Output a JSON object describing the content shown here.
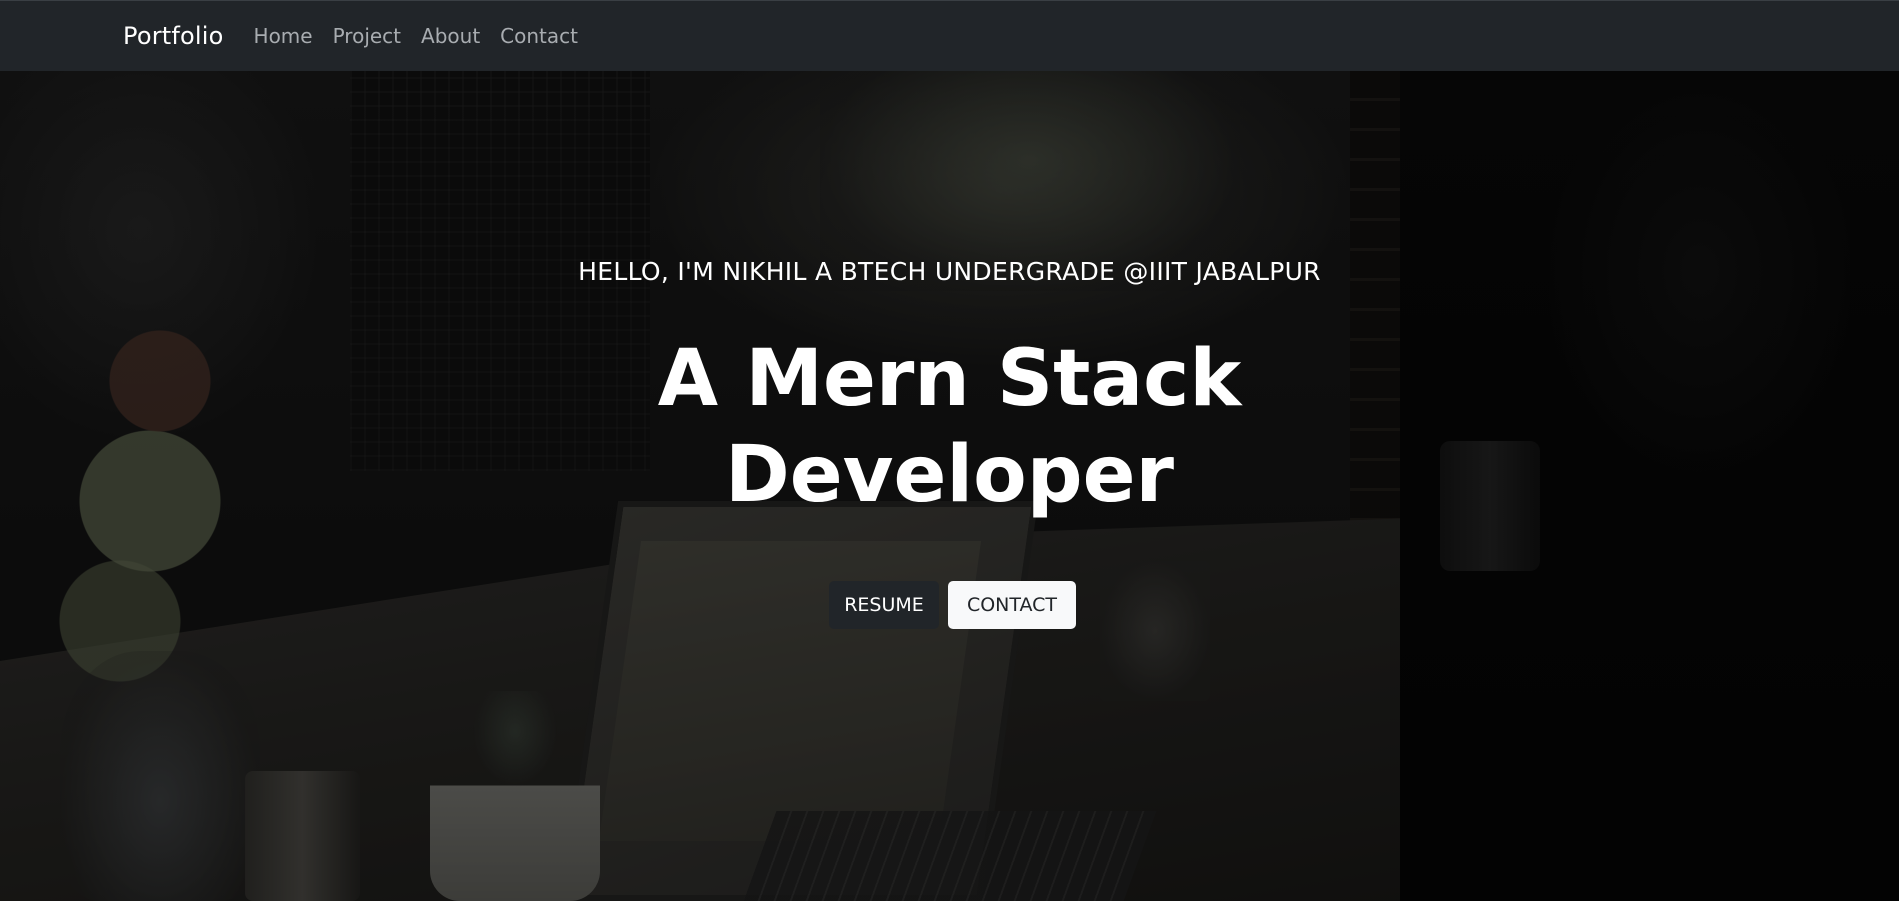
{
  "navbar": {
    "brand": "Portfolio",
    "links": [
      {
        "label": "Home"
      },
      {
        "label": "Project"
      },
      {
        "label": "About"
      },
      {
        "label": "Contact"
      }
    ]
  },
  "hero": {
    "tagline": "HELLO, I'M NIKHIL A BTECH UNDERGRADE @IIIT JABALPUR",
    "headline_line1": "A Mern Stack",
    "headline_line2": "Developer",
    "buttons": {
      "resume": "RESUME",
      "contact": "CONTACT"
    }
  },
  "colors": {
    "navbar_bg": "#212529",
    "nav_link": "#a8acb0",
    "text_primary": "#ffffff",
    "resume_bg": "#212529",
    "contact_bg": "#f8f9fa"
  }
}
